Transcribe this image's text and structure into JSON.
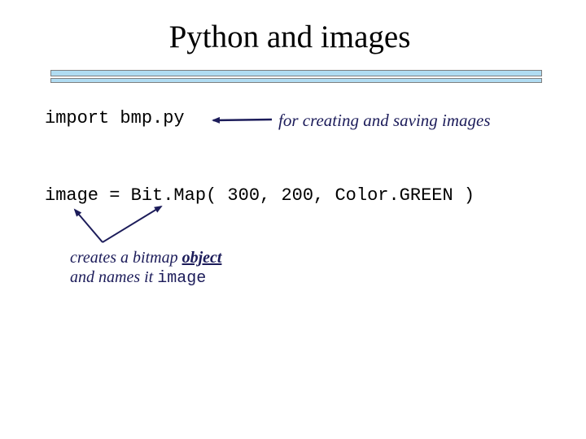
{
  "slide": {
    "title": "Python and images",
    "import_code": "import bmp.py",
    "import_note": "for creating and saving images",
    "image_code": "image = Bit.Map( 300, 200, Color.GREEN )",
    "callout": {
      "line1_prefix": "creates a bitmap ",
      "line1_emphasis": "object",
      "line2_prefix": "and names it ",
      "line2_code": "image"
    }
  },
  "colors": {
    "title_text": "#000000",
    "note_text": "#1c1c5a",
    "rule_fill": "#b0dcf2",
    "rule_border": "#7f7f7f",
    "arrow": "#1c1c5a"
  }
}
